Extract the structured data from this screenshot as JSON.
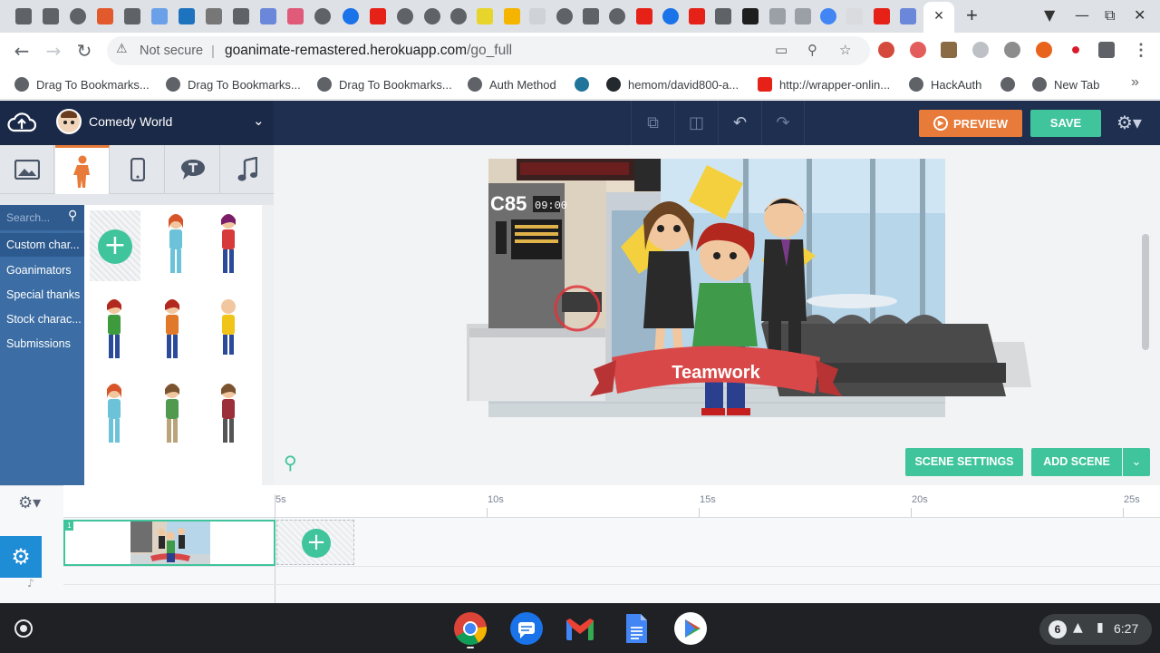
{
  "browser": {
    "url_warning": "Not secure",
    "url_host": "goanimate-remastered.herokuapp.com",
    "url_path": "/go_full",
    "tab_close": "×",
    "new_tab": "+"
  },
  "bookmarks": [
    {
      "label": "Drag To Bookmarks..."
    },
    {
      "label": "Drag To Bookmarks..."
    },
    {
      "label": "Drag To Bookmarks..."
    },
    {
      "label": "Auth Method"
    },
    {
      "label": ""
    },
    {
      "label": "hemom/david800-a..."
    },
    {
      "label": "http://wrapper-onlin..."
    },
    {
      "label": "HackAuth"
    },
    {
      "label": ""
    },
    {
      "label": "New Tab"
    }
  ],
  "app": {
    "project_title": "Comedy World",
    "preview_label": "PREVIEW",
    "save_label": "SAVE"
  },
  "assets": {
    "search_placeholder": "Search...",
    "categories": [
      "Custom char...",
      "Goanimators",
      "Special thanks",
      "Stock charac...",
      "Submissions"
    ]
  },
  "stage": {
    "banner_text": "Teamwork",
    "station_code": "C85",
    "station_time": "09:00"
  },
  "scene_actions": {
    "scene_settings": "SCENE SETTINGS",
    "add_scene": "ADD SCENE"
  },
  "timeline": {
    "ticks": [
      "5s",
      "10s",
      "15s",
      "20s",
      "25s"
    ],
    "scene_number": "1"
  },
  "shelf": {
    "notification_count": "6",
    "clock": "6:27"
  },
  "colors": {
    "accent_green": "#3fc49b",
    "accent_orange": "#e87a3a",
    "header_navy": "#1f2f4f",
    "category_blue": "#3c6ea5"
  }
}
